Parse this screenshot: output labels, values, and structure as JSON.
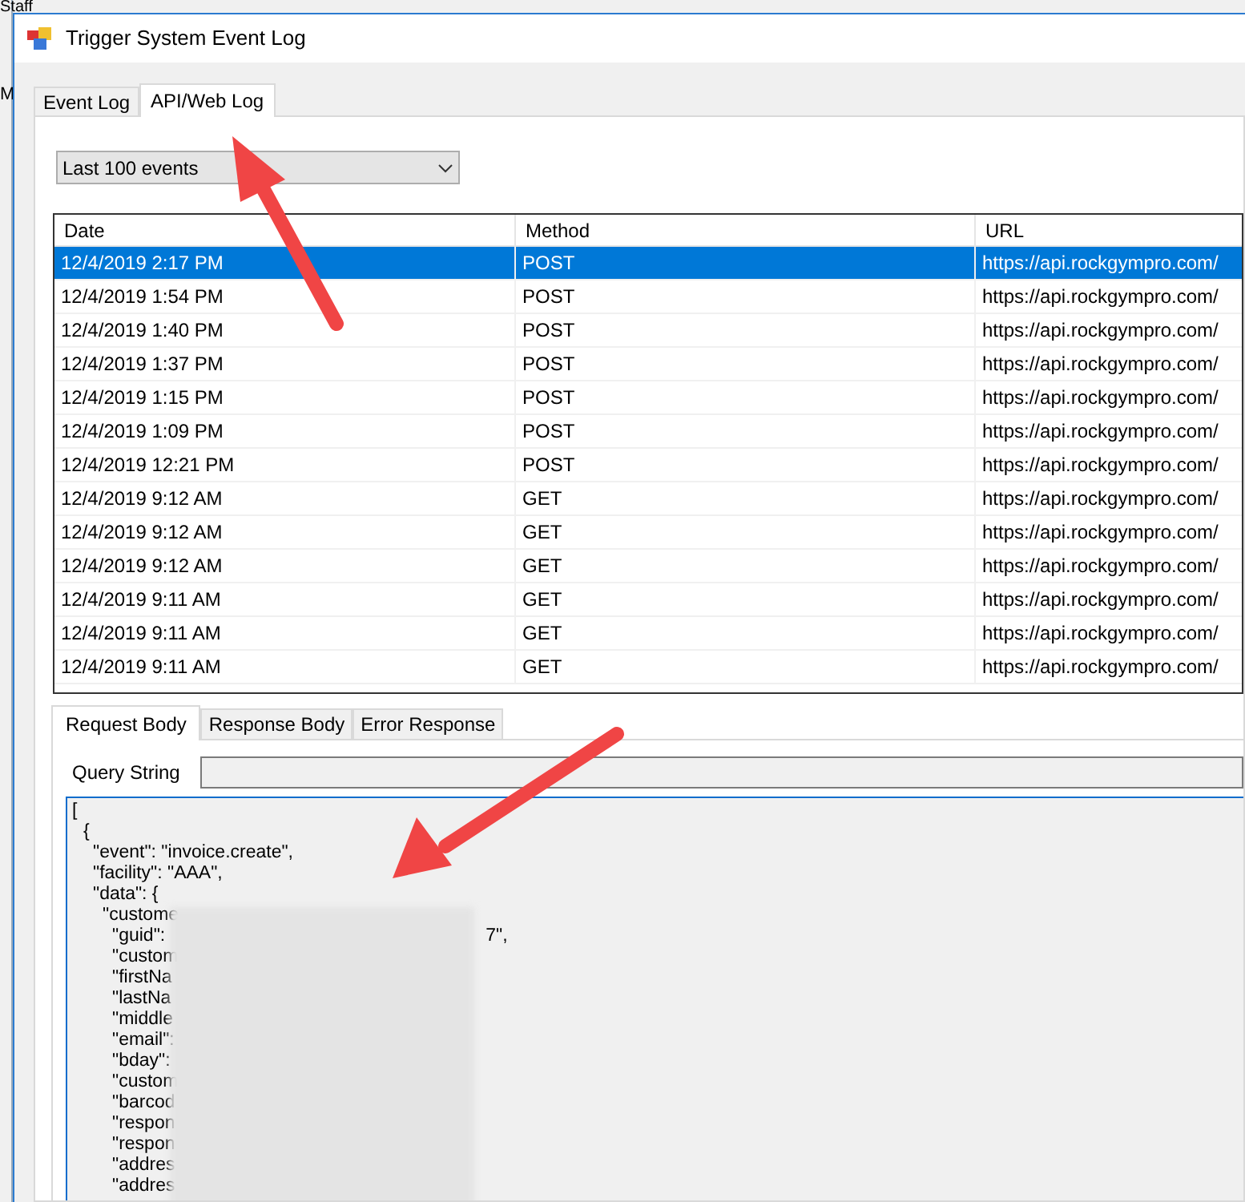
{
  "background_window": {
    "title": "Staff",
    "label": "M"
  },
  "window": {
    "title": "Trigger System Event Log"
  },
  "tabs": [
    {
      "label": "Event Log",
      "selected": false
    },
    {
      "label": "API/Web Log",
      "selected": true
    }
  ],
  "filter": {
    "value": "Last 100 events"
  },
  "table": {
    "columns": [
      "Date",
      "Method",
      "URL"
    ],
    "rows": [
      {
        "date": "12/4/2019 2:17 PM",
        "method": "POST",
        "url": "https://api.rockgympro.com/",
        "selected": true
      },
      {
        "date": "12/4/2019 1:54 PM",
        "method": "POST",
        "url": "https://api.rockgympro.com/",
        "selected": false
      },
      {
        "date": "12/4/2019 1:40 PM",
        "method": "POST",
        "url": "https://api.rockgympro.com/",
        "selected": false
      },
      {
        "date": "12/4/2019 1:37 PM",
        "method": "POST",
        "url": "https://api.rockgympro.com/",
        "selected": false
      },
      {
        "date": "12/4/2019 1:15 PM",
        "method": "POST",
        "url": "https://api.rockgympro.com/",
        "selected": false
      },
      {
        "date": "12/4/2019 1:09 PM",
        "method": "POST",
        "url": "https://api.rockgympro.com/",
        "selected": false
      },
      {
        "date": "12/4/2019 12:21 PM",
        "method": "POST",
        "url": "https://api.rockgympro.com/",
        "selected": false
      },
      {
        "date": "12/4/2019 9:12 AM",
        "method": "GET",
        "url": "https://api.rockgympro.com/",
        "selected": false
      },
      {
        "date": "12/4/2019 9:12 AM",
        "method": "GET",
        "url": "https://api.rockgympro.com/",
        "selected": false
      },
      {
        "date": "12/4/2019 9:12 AM",
        "method": "GET",
        "url": "https://api.rockgympro.com/",
        "selected": false
      },
      {
        "date": "12/4/2019 9:11 AM",
        "method": "GET",
        "url": "https://api.rockgympro.com/",
        "selected": false
      },
      {
        "date": "12/4/2019 9:11 AM",
        "method": "GET",
        "url": "https://api.rockgympro.com/",
        "selected": false
      },
      {
        "date": "12/4/2019 9:11 AM",
        "method": "GET",
        "url": "https://api.rockgympro.com/",
        "selected": false
      }
    ]
  },
  "detail_tabs": [
    {
      "label": "Request Body",
      "selected": true
    },
    {
      "label": "Response Body",
      "selected": false
    },
    {
      "label": "Error Response",
      "selected": false
    }
  ],
  "query_string": {
    "label": "Query String"
  },
  "body_lines": [
    {
      "text": "[",
      "children": [
        {
          "text": "{",
          "children": [
            {
              "text": "\"event\": \"invoice.create\","
            },
            {
              "text": "\"facility\": \"AAA\","
            },
            {
              "text": "\"data\": {",
              "children": [
                {
                  "text": "\"custome",
                  "children": [
                    {
                      "text": "\"guid\":",
                      "tail": "7\","
                    },
                    {
                      "text": "\"custom"
                    },
                    {
                      "text": "\"firstNa"
                    },
                    {
                      "text": "\"lastNa"
                    },
                    {
                      "text": "\"middle"
                    },
                    {
                      "text": "\"email\":"
                    },
                    {
                      "text": "\"bday\":"
                    },
                    {
                      "text": "\"custom"
                    },
                    {
                      "text": "\"barcod"
                    },
                    {
                      "text": "\"respon"
                    },
                    {
                      "text": "\"respon"
                    },
                    {
                      "text": "\"addres"
                    },
                    {
                      "text": "\"addres"
                    }
                  ]
                }
              ]
            }
          ]
        }
      ]
    }
  ]
}
